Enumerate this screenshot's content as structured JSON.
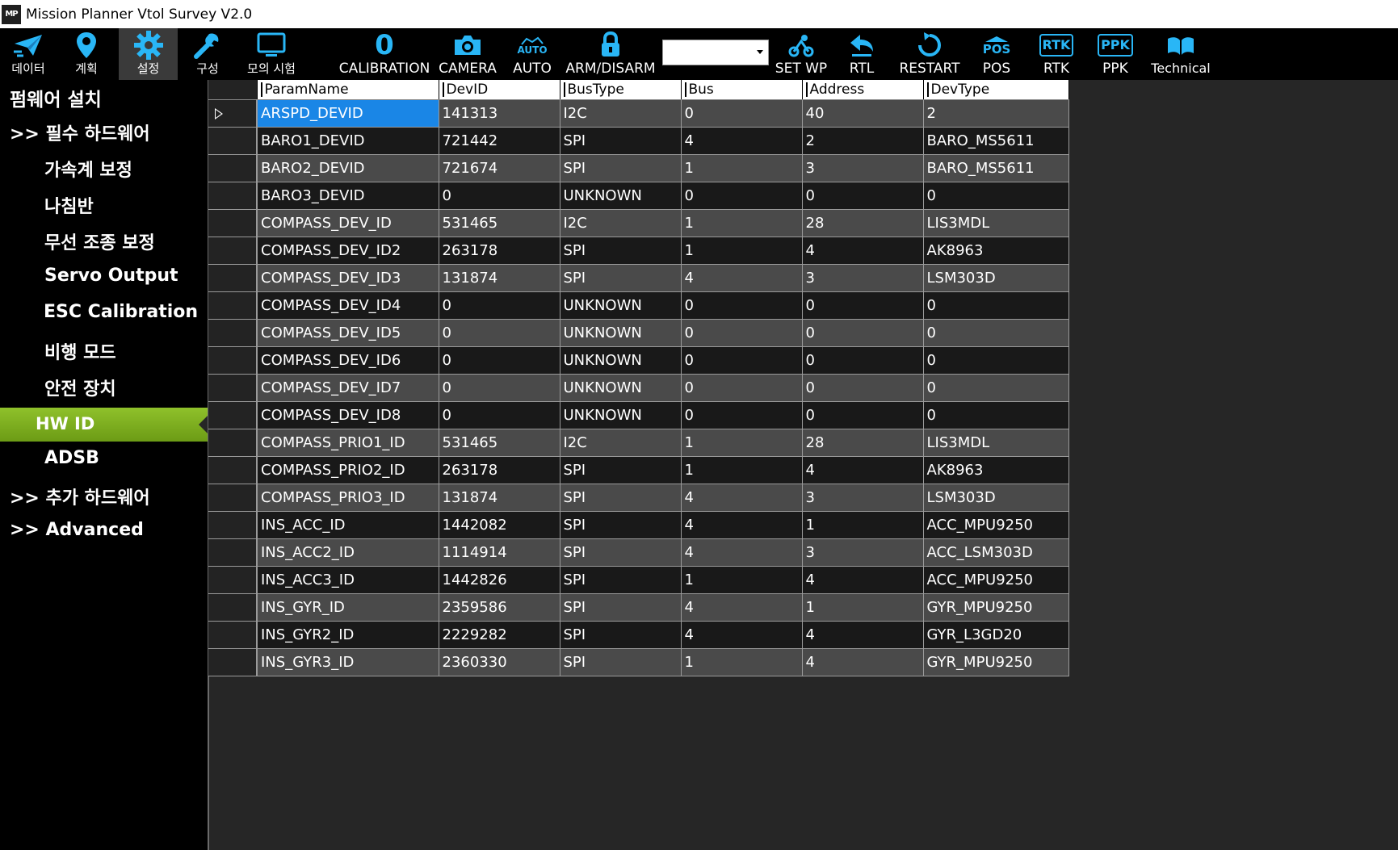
{
  "window": {
    "title": "Mission Planner Vtol Survey V2.0",
    "icon_text": "MP"
  },
  "toolbar": {
    "items": [
      {
        "label": "데이터",
        "icon": "send-plane-icon"
      },
      {
        "label": "계획",
        "icon": "map-pin-icon"
      },
      {
        "label": "설정",
        "icon": "gear-icon",
        "active": true
      },
      {
        "label": "구성",
        "icon": "wrench-icon"
      },
      {
        "label": "모의 시험",
        "icon": "monitor-icon"
      },
      {
        "label": "CALIBRATION",
        "icon": "zero-icon"
      },
      {
        "label": "CAMERA",
        "icon": "camera-icon"
      },
      {
        "label": "AUTO",
        "icon": "auto-icon"
      },
      {
        "label": "ARM/DISARM",
        "icon": "lock-icon"
      },
      {
        "label": "SET WP",
        "icon": "set-wp-icon"
      },
      {
        "label": "RTL",
        "icon": "return-icon"
      },
      {
        "label": "RESTART",
        "icon": "restart-icon"
      },
      {
        "label": "POS",
        "icon": "pos-icon"
      },
      {
        "label": "RTK",
        "icon": "rtk-icon"
      },
      {
        "label": "PPK",
        "icon": "ppk-icon"
      },
      {
        "label": "Technical",
        "icon": "book-icon"
      }
    ],
    "combo_value": "",
    "icon_texts": {
      "auto": "AUTO",
      "pos": "POS",
      "rtk": "RTK",
      "ppk": "PPK",
      "zero": "0"
    },
    "accent": "#29b6f6"
  },
  "sidebar": {
    "title": "펌웨어 설치",
    "required_hw": ">> 필수 하드웨어",
    "items": [
      "가속계 보정",
      "나침반",
      "무선 조종 보정",
      "Servo Output",
      "ESC Calibration",
      "비행 모드",
      "안전 장치",
      "HW ID",
      "ADSB"
    ],
    "extra_hw": ">> 추가 하드웨어",
    "advanced": ">> Advanced",
    "active_color": "#7cad1e"
  },
  "grid": {
    "columns": [
      "ParamName",
      "DevID",
      "BusType",
      "Bus",
      "Address",
      "DevType"
    ],
    "rows": [
      [
        "ARSPD_DEVID",
        "141313",
        "I2C",
        "0",
        "40",
        "2"
      ],
      [
        "BARO1_DEVID",
        "721442",
        "SPI",
        "4",
        "2",
        "BARO_MS5611"
      ],
      [
        "BARO2_DEVID",
        "721674",
        "SPI",
        "1",
        "3",
        "BARO_MS5611"
      ],
      [
        "BARO3_DEVID",
        "0",
        "UNKNOWN",
        "0",
        "0",
        "0"
      ],
      [
        "COMPASS_DEV_ID",
        "531465",
        "I2C",
        "1",
        "28",
        "LIS3MDL"
      ],
      [
        "COMPASS_DEV_ID2",
        "263178",
        "SPI",
        "1",
        "4",
        "AK8963"
      ],
      [
        "COMPASS_DEV_ID3",
        "131874",
        "SPI",
        "4",
        "3",
        "LSM303D"
      ],
      [
        "COMPASS_DEV_ID4",
        "0",
        "UNKNOWN",
        "0",
        "0",
        "0"
      ],
      [
        "COMPASS_DEV_ID5",
        "0",
        "UNKNOWN",
        "0",
        "0",
        "0"
      ],
      [
        "COMPASS_DEV_ID6",
        "0",
        "UNKNOWN",
        "0",
        "0",
        "0"
      ],
      [
        "COMPASS_DEV_ID7",
        "0",
        "UNKNOWN",
        "0",
        "0",
        "0"
      ],
      [
        "COMPASS_DEV_ID8",
        "0",
        "UNKNOWN",
        "0",
        "0",
        "0"
      ],
      [
        "COMPASS_PRIO1_ID",
        "531465",
        "I2C",
        "1",
        "28",
        "LIS3MDL"
      ],
      [
        "COMPASS_PRIO2_ID",
        "263178",
        "SPI",
        "1",
        "4",
        "AK8963"
      ],
      [
        "COMPASS_PRIO3_ID",
        "131874",
        "SPI",
        "4",
        "3",
        "LSM303D"
      ],
      [
        "INS_ACC_ID",
        "1442082",
        "SPI",
        "4",
        "1",
        "ACC_MPU9250"
      ],
      [
        "INS_ACC2_ID",
        "1114914",
        "SPI",
        "4",
        "3",
        "ACC_LSM303D"
      ],
      [
        "INS_ACC3_ID",
        "1442826",
        "SPI",
        "1",
        "4",
        "ACC_MPU9250"
      ],
      [
        "INS_GYR_ID",
        "2359586",
        "SPI",
        "4",
        "1",
        "GYR_MPU9250"
      ],
      [
        "INS_GYR2_ID",
        "2229282",
        "SPI",
        "4",
        "4",
        "GYR_L3GD20"
      ],
      [
        "INS_GYR3_ID",
        "2360330",
        "SPI",
        "1",
        "4",
        "GYR_MPU9250"
      ]
    ],
    "selected_row": 0,
    "selected_color": "#1a86e6"
  }
}
